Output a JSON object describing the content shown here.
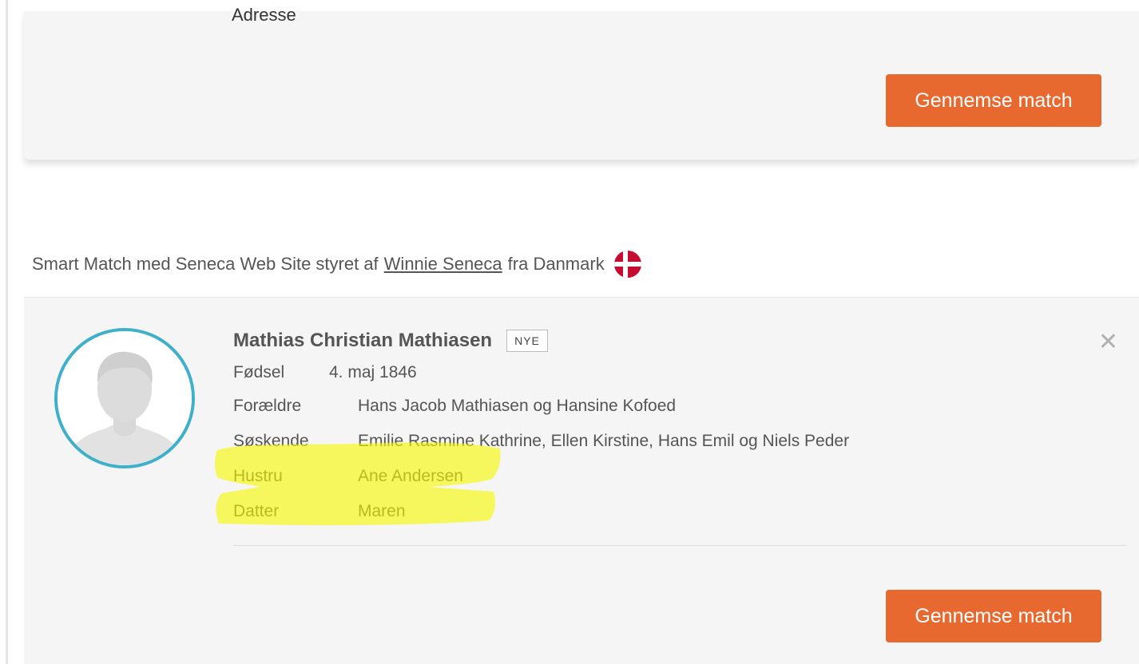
{
  "top_card": {
    "cut_label": "Adresse",
    "review_button": "Gennemse match"
  },
  "headline": {
    "prefix": "Smart Match med Seneca Web Site styret af",
    "manager_link": "Winnie Seneca",
    "suffix": "fra Danmark",
    "flag_icon": "denmark-flag-icon"
  },
  "match": {
    "name": "Mathias Christian Mathiasen",
    "badge": "NYE",
    "facts": [
      {
        "label": "Fødsel",
        "value": "4. maj 1846"
      },
      {
        "label": "Forældre",
        "value": "Hans Jacob Mathiasen og Hansine Kofoed"
      },
      {
        "label": "Søskende",
        "value": "Emilie Rasmine Kathrine, Ellen Kirstine, Hans Emil og Niels Peder"
      },
      {
        "label": "Hustru",
        "value": "Ane Andersen"
      },
      {
        "label": "Datter",
        "value": "Maren"
      }
    ],
    "review_button": "Gennemse match",
    "close_icon": "close-icon",
    "avatar_icon": "person-silhouette-icon"
  },
  "colors": {
    "accent_button": "#e8692f",
    "avatar_ring": "#3fb0c9",
    "card_bg": "#f5f5f5",
    "highlight": "#f7f700"
  }
}
